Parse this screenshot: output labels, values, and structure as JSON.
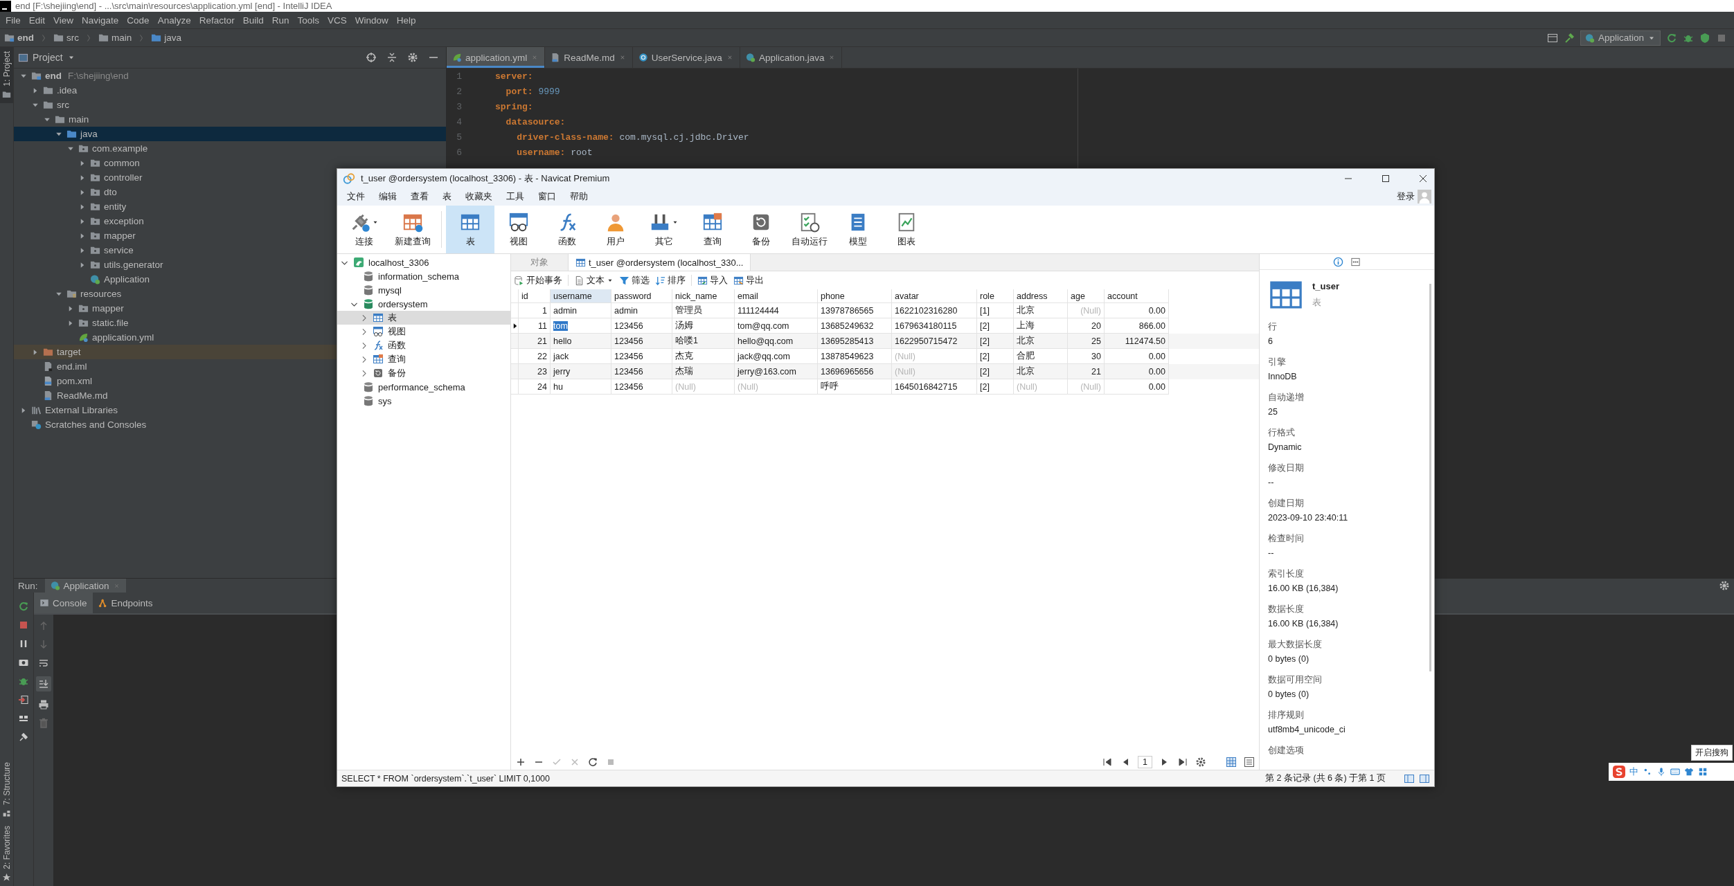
{
  "ide": {
    "title": "end [F:\\shejiing\\end] - ...\\src\\main\\resources\\application.yml [end] - IntelliJ IDEA",
    "menu": [
      "File",
      "Edit",
      "View",
      "Navigate",
      "Code",
      "Analyze",
      "Refactor",
      "Build",
      "Run",
      "Tools",
      "VCS",
      "Window",
      "Help"
    ],
    "breadcrumb": [
      {
        "label": "end",
        "kind": "module"
      },
      {
        "label": "src",
        "kind": "folder"
      },
      {
        "label": "main",
        "kind": "folder"
      },
      {
        "label": "java",
        "kind": "srcfolder"
      }
    ],
    "run_config": "Application",
    "side_tabs_top": [
      {
        "label": "1: Project",
        "selected": true
      }
    ],
    "side_tabs_bottom": [
      {
        "label": "7: Structure",
        "kind": "structure",
        "selected": false
      },
      {
        "label": "2: Favorites",
        "kind": "star",
        "selected": false
      }
    ],
    "project_panel": {
      "title": "Project",
      "tree": [
        {
          "label": "end",
          "kind": "module",
          "path": "F:\\shejiing\\end",
          "expanded": true,
          "selected": false,
          "children": [
            {
              "label": ".idea",
              "kind": "folder",
              "expanded": false,
              "selected": false
            },
            {
              "label": "src",
              "kind": "folder",
              "expanded": true,
              "selected": false,
              "children": [
                {
                  "label": "main",
                  "kind": "folder",
                  "expanded": true,
                  "selected": false,
                  "children": [
                    {
                      "label": "java",
                      "kind": "srcfolder",
                      "expanded": true,
                      "selected": true,
                      "children": [
                        {
                          "label": "com.example",
                          "kind": "package",
                          "expanded": true,
                          "selected": false,
                          "children": [
                            {
                              "label": "common",
                              "kind": "package",
                              "expanded": false,
                              "selected": false
                            },
                            {
                              "label": "controller",
                              "kind": "package",
                              "expanded": false,
                              "selected": false
                            },
                            {
                              "label": "dto",
                              "kind": "package",
                              "expanded": false,
                              "selected": false
                            },
                            {
                              "label": "entity",
                              "kind": "package",
                              "expanded": false,
                              "selected": false
                            },
                            {
                              "label": "exception",
                              "kind": "package",
                              "expanded": false,
                              "selected": false
                            },
                            {
                              "label": "mapper",
                              "kind": "package",
                              "expanded": false,
                              "selected": false
                            },
                            {
                              "label": "service",
                              "kind": "package",
                              "expanded": false,
                              "selected": false
                            },
                            {
                              "label": "utils.generator",
                              "kind": "package",
                              "expanded": false,
                              "selected": false
                            },
                            {
                              "label": "Application",
                              "kind": "spring",
                              "selected": false
                            }
                          ]
                        }
                      ]
                    },
                    {
                      "label": "resources",
                      "kind": "resfolder",
                      "expanded": true,
                      "selected": false,
                      "children": [
                        {
                          "label": "mapper",
                          "kind": "package",
                          "expanded": false,
                          "selected": false
                        },
                        {
                          "label": "static.file",
                          "kind": "package",
                          "expanded": false,
                          "selected": false
                        },
                        {
                          "label": "application.yml",
                          "kind": "yml",
                          "selected": false
                        }
                      ]
                    }
                  ]
                }
              ]
            },
            {
              "label": "target",
              "kind": "excluded",
              "expanded": false,
              "selected": false
            },
            {
              "label": "end.iml",
              "kind": "iml",
              "selected": false
            },
            {
              "label": "pom.xml",
              "kind": "xml",
              "selected": false
            },
            {
              "label": "ReadMe.md",
              "kind": "md",
              "selected": false
            }
          ]
        },
        {
          "label": "External Libraries",
          "kind": "libs",
          "expanded": false,
          "selected": false
        },
        {
          "label": "Scratches and Consoles",
          "kind": "scratch",
          "selected": false
        }
      ]
    },
    "editor": {
      "tabs": [
        {
          "label": "application.yml",
          "kind": "yml",
          "selected": true
        },
        {
          "label": "ReadMe.md",
          "kind": "md",
          "selected": false
        },
        {
          "label": "UserService.java",
          "kind": "cclass",
          "selected": false
        },
        {
          "label": "Application.java",
          "kind": "spring",
          "selected": false
        }
      ],
      "lines": [
        {
          "number": "1",
          "key": "server:"
        },
        {
          "number": "2",
          "key": "  port:",
          "value": " 9999",
          "kind": "number"
        },
        {
          "number": "3",
          "key": "spring:"
        },
        {
          "number": "4",
          "key": "  datasource:"
        },
        {
          "number": "5",
          "key": "    driver-class-name:",
          "value": " com.mysql.cj.jdbc.Driver",
          "kind": "text"
        },
        {
          "number": "6",
          "key": "    username:",
          "value": " root",
          "kind": "text"
        }
      ]
    },
    "run_panel": {
      "label": "Run:",
      "config_tab": "Application",
      "tabs": [
        {
          "label": "Console",
          "kind": "console",
          "selected": true
        },
        {
          "label": "Endpoints",
          "kind": "endpoints",
          "selected": false
        }
      ]
    }
  },
  "navicat": {
    "title": "t_user @ordersystem (localhost_3306) - 表 - Navicat Premium",
    "menu": [
      "文件",
      "编辑",
      "查看",
      "表",
      "收藏夹",
      "工具",
      "窗口",
      "帮助"
    ],
    "login": "登录",
    "toolbar": [
      {
        "label": "连接",
        "kind": "plug",
        "dropdown": true,
        "selected": false
      },
      {
        "label": "新建查询",
        "kind": "newquery",
        "selected": false
      },
      {
        "label": "表",
        "kind": "table",
        "selected": true
      },
      {
        "label": "视图",
        "kind": "view",
        "selected": false
      },
      {
        "label": "函数",
        "kind": "func",
        "selected": false
      },
      {
        "label": "用户",
        "kind": "user",
        "selected": false
      },
      {
        "label": "其它",
        "kind": "tools",
        "dropdown": true,
        "selected": false
      },
      {
        "label": "查询",
        "kind": "query",
        "selected": false
      },
      {
        "label": "备份",
        "kind": "backup",
        "selected": false
      },
      {
        "label": "自动运行",
        "kind": "autorun",
        "selected": false
      },
      {
        "label": "模型",
        "kind": "model",
        "selected": false
      },
      {
        "label": "图表",
        "kind": "chart",
        "selected": false
      }
    ],
    "tree": [
      {
        "label": "localhost_3306",
        "kind": "server",
        "expanded": true,
        "selected": false,
        "children": [
          {
            "label": "information_schema",
            "kind": "db",
            "open": false,
            "selected": false
          },
          {
            "label": "mysql",
            "kind": "db",
            "open": false,
            "selected": false
          },
          {
            "label": "ordersystem",
            "kind": "db",
            "open": true,
            "expanded": true,
            "selected": false,
            "children": [
              {
                "label": "表",
                "kind": "table",
                "expanded": false,
                "selected": true
              },
              {
                "label": "视图",
                "kind": "view",
                "expanded": false,
                "selected": false
              },
              {
                "label": "函数",
                "kind": "func",
                "expanded": false,
                "selected": false
              },
              {
                "label": "查询",
                "kind": "query",
                "expanded": false,
                "selected": false
              },
              {
                "label": "备份",
                "kind": "backup",
                "expanded": false,
                "selected": false
              }
            ]
          },
          {
            "label": "performance_schema",
            "kind": "db",
            "open": false,
            "selected": false
          },
          {
            "label": "sys",
            "kind": "db",
            "open": false,
            "selected": false
          }
        ]
      }
    ],
    "tabs": [
      {
        "label": "对象",
        "kind": "objects",
        "selected": false
      },
      {
        "label": "t_user @ordersystem (localhost_330...",
        "kind": "table",
        "selected": true
      }
    ],
    "actions": [
      {
        "label": "开始事务",
        "kind": "transaction"
      },
      {
        "label": "文本",
        "kind": "doc",
        "dropdown": true
      },
      {
        "label": "筛选",
        "kind": "filter"
      },
      {
        "label": "排序",
        "kind": "sort"
      },
      {
        "label": "导入",
        "kind": "import"
      },
      {
        "label": "导出",
        "kind": "export"
      }
    ],
    "table": {
      "columns": [
        {
          "label": "id",
          "kind": "number",
          "selected": false
        },
        {
          "label": "username",
          "selected": true
        },
        {
          "label": "password",
          "selected": false
        },
        {
          "label": "nick_name",
          "selected": false
        },
        {
          "label": "email",
          "selected": false
        },
        {
          "label": "phone",
          "selected": false
        },
        {
          "label": "avatar",
          "selected": false
        },
        {
          "label": "role",
          "selected": false
        },
        {
          "label": "address",
          "selected": false
        },
        {
          "label": "age",
          "kind": "number",
          "selected": false
        },
        {
          "label": "account",
          "kind": "number",
          "selected": false
        }
      ],
      "rows": [
        {
          "selected": false,
          "cells": [
            "1",
            "admin",
            "admin",
            "管理员",
            "111124444",
            "13978786565",
            "1622102316280",
            "[1]",
            "北京",
            {
              "text": "(Null)",
              "null": true
            },
            "0.00"
          ]
        },
        {
          "selected": true,
          "cells": [
            "11",
            "tom",
            "123456",
            "汤姆",
            "tom@qq.com",
            "13685249632",
            "1679634180115",
            "[2]",
            "上海",
            "20",
            "866.00"
          ]
        },
        {
          "selected": false,
          "cells": [
            "21",
            "hello",
            "123456",
            "哈喽1",
            "hello@qq.com",
            "13695285413",
            "1622950715472",
            "[2]",
            "北京",
            "25",
            "112474.50"
          ]
        },
        {
          "selected": false,
          "cells": [
            "22",
            "jack",
            "123456",
            "杰克",
            "jack@qq.com",
            "13878549623",
            {
              "text": "(Null)",
              "null": true
            },
            "[2]",
            "合肥",
            "30",
            "0.00"
          ]
        },
        {
          "selected": false,
          "cells": [
            "23",
            "jerry",
            "123456",
            "杰瑞",
            "jerry@163.com",
            "13696965656",
            {
              "text": "(Null)",
              "null": true
            },
            "[2]",
            "北京",
            "21",
            "0.00"
          ]
        },
        {
          "selected": false,
          "cells": [
            "24",
            "hu",
            "123456",
            {
              "text": "(Null)",
              "null": true
            },
            {
              "text": "(Null)",
              "null": true
            },
            "呼呼",
            "1645016842715",
            "[2]",
            {
              "text": "(Null)",
              "null": true
            },
            {
              "text": "(Null)",
              "null": true
            },
            "0.00"
          ]
        }
      ]
    },
    "pager": {
      "page": "1"
    },
    "info_panel": {
      "tabs": [
        {
          "kind": "info",
          "selected": true
        },
        {
          "kind": "ddl",
          "selected": false
        }
      ],
      "name": "t_user",
      "type": "表",
      "properties": [
        {
          "label": "行",
          "value": "6"
        },
        {
          "label": "引擎",
          "value": "InnoDB"
        },
        {
          "label": "自动递增",
          "value": "25"
        },
        {
          "label": "行格式",
          "value": "Dynamic"
        },
        {
          "label": "修改日期",
          "value": "--"
        },
        {
          "label": "创建日期",
          "value": "2023-09-10 23:40:11"
        },
        {
          "label": "检查时间",
          "value": "--"
        },
        {
          "label": "索引长度",
          "value": "16.00 KB (16,384)"
        },
        {
          "label": "数据长度",
          "value": "16.00 KB (16,384)"
        },
        {
          "label": "最大数据长度",
          "value": "0 bytes (0)"
        },
        {
          "label": "数据可用空间",
          "value": "0 bytes (0)"
        },
        {
          "label": "排序规则",
          "value": "utf8mb4_unicode_ci"
        },
        {
          "label": "创建选项"
        }
      ]
    },
    "status": {
      "sql": "SELECT * FROM `ordersystem`.`t_user` LIMIT 0,1000",
      "records": "第 2 条记录 (共 6 条) 于第 1 页"
    }
  },
  "ime": {
    "mode": "中",
    "tooltip": "开启搜狗"
  }
}
